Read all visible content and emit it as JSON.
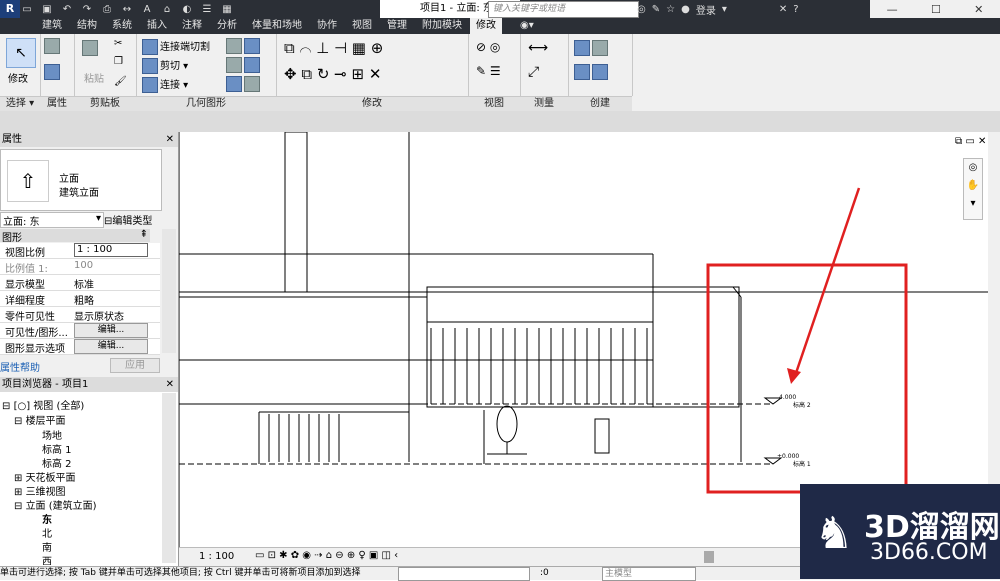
{
  "titlebar": {
    "doc_title": "项目1 - 立面: 东",
    "search_placeholder": "键入关键字或短语",
    "login": "登录",
    "help": "?"
  },
  "tabs": [
    "建筑",
    "结构",
    "系统",
    "插入",
    "注释",
    "分析",
    "体量和场地",
    "协作",
    "视图",
    "管理",
    "附加模块",
    "修改"
  ],
  "ribbon": {
    "modify_label": "修改",
    "paste_label": "粘贴",
    "join_cut_label": "连接端切割",
    "cut_label": "剪切",
    "join_label": "连接",
    "panels": [
      "选择",
      "属性",
      "剪贴板",
      "几何图形",
      "修改",
      "视图",
      "测量",
      "创建"
    ]
  },
  "properties": {
    "title": "属性",
    "type_name": "立面",
    "type_sub": "建筑立面",
    "selector": "立面: 东",
    "edit_type": "编辑类型",
    "group": "图形",
    "rows": [
      {
        "k": "视图比例",
        "v": "1 : 100"
      },
      {
        "k": "比例值 1:",
        "v": "100"
      },
      {
        "k": "显示模型",
        "v": "标准"
      },
      {
        "k": "详细程度",
        "v": "粗略"
      },
      {
        "k": "零件可见性",
        "v": "显示原状态"
      },
      {
        "k": "可见性/图形...",
        "v": "编辑..."
      },
      {
        "k": "图形显示选项",
        "v": "编辑..."
      }
    ],
    "help": "属性帮助",
    "apply": "应用"
  },
  "browser": {
    "title": "项目浏览器 - 项目1",
    "items": [
      {
        "label": "视图 (全部)"
      },
      {
        "label": "楼层平面"
      },
      {
        "label": "场地"
      },
      {
        "label": "标高 1"
      },
      {
        "label": "标高 2"
      },
      {
        "label": "天花板平面"
      },
      {
        "label": "三维视图"
      },
      {
        "label": "立面 (建筑立面)"
      },
      {
        "label": "东"
      },
      {
        "label": "北"
      },
      {
        "label": "南"
      },
      {
        "label": "西"
      }
    ]
  },
  "canvas": {
    "level1_value": "4.000",
    "level1_name": "标高 2",
    "level0_value": "±0.000",
    "level0_name": "标高 1",
    "annotation_color": "#e02020"
  },
  "viewctrl": {
    "scale": "1 : 100"
  },
  "status": {
    "text": "单击可进行选择; 按 Tab 键并单击可选择其他项目; 按 Ctrl 键并单击可将新项目添加到选择",
    "coord": ":0",
    "model": "主模型"
  },
  "watermark": {
    "big": "3D溜溜网",
    "small": "3D66.COM"
  }
}
